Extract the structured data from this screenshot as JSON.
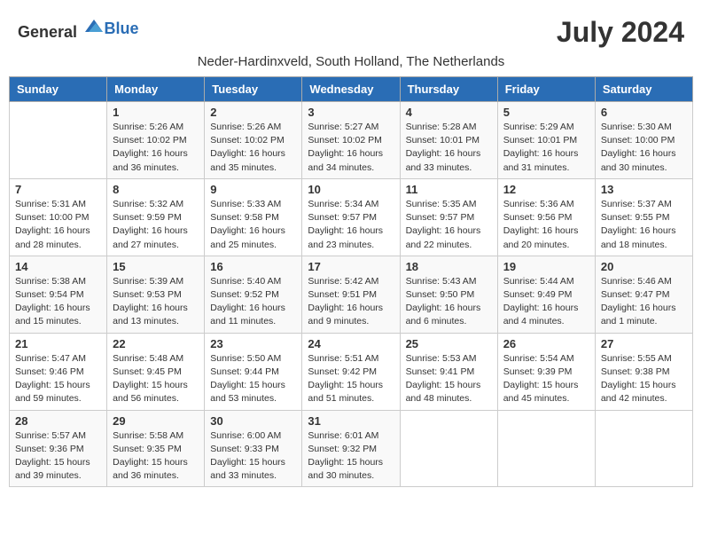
{
  "header": {
    "logo_general": "General",
    "logo_blue": "Blue",
    "month_title": "July 2024",
    "subtitle": "Neder-Hardinxveld, South Holland, The Netherlands"
  },
  "days_of_week": [
    "Sunday",
    "Monday",
    "Tuesday",
    "Wednesday",
    "Thursday",
    "Friday",
    "Saturday"
  ],
  "weeks": [
    [
      {
        "day": "",
        "info": ""
      },
      {
        "day": "1",
        "info": "Sunrise: 5:26 AM\nSunset: 10:02 PM\nDaylight: 16 hours\nand 36 minutes."
      },
      {
        "day": "2",
        "info": "Sunrise: 5:26 AM\nSunset: 10:02 PM\nDaylight: 16 hours\nand 35 minutes."
      },
      {
        "day": "3",
        "info": "Sunrise: 5:27 AM\nSunset: 10:02 PM\nDaylight: 16 hours\nand 34 minutes."
      },
      {
        "day": "4",
        "info": "Sunrise: 5:28 AM\nSunset: 10:01 PM\nDaylight: 16 hours\nand 33 minutes."
      },
      {
        "day": "5",
        "info": "Sunrise: 5:29 AM\nSunset: 10:01 PM\nDaylight: 16 hours\nand 31 minutes."
      },
      {
        "day": "6",
        "info": "Sunrise: 5:30 AM\nSunset: 10:00 PM\nDaylight: 16 hours\nand 30 minutes."
      }
    ],
    [
      {
        "day": "7",
        "info": "Sunrise: 5:31 AM\nSunset: 10:00 PM\nDaylight: 16 hours\nand 28 minutes."
      },
      {
        "day": "8",
        "info": "Sunrise: 5:32 AM\nSunset: 9:59 PM\nDaylight: 16 hours\nand 27 minutes."
      },
      {
        "day": "9",
        "info": "Sunrise: 5:33 AM\nSunset: 9:58 PM\nDaylight: 16 hours\nand 25 minutes."
      },
      {
        "day": "10",
        "info": "Sunrise: 5:34 AM\nSunset: 9:57 PM\nDaylight: 16 hours\nand 23 minutes."
      },
      {
        "day": "11",
        "info": "Sunrise: 5:35 AM\nSunset: 9:57 PM\nDaylight: 16 hours\nand 22 minutes."
      },
      {
        "day": "12",
        "info": "Sunrise: 5:36 AM\nSunset: 9:56 PM\nDaylight: 16 hours\nand 20 minutes."
      },
      {
        "day": "13",
        "info": "Sunrise: 5:37 AM\nSunset: 9:55 PM\nDaylight: 16 hours\nand 18 minutes."
      }
    ],
    [
      {
        "day": "14",
        "info": "Sunrise: 5:38 AM\nSunset: 9:54 PM\nDaylight: 16 hours\nand 15 minutes."
      },
      {
        "day": "15",
        "info": "Sunrise: 5:39 AM\nSunset: 9:53 PM\nDaylight: 16 hours\nand 13 minutes."
      },
      {
        "day": "16",
        "info": "Sunrise: 5:40 AM\nSunset: 9:52 PM\nDaylight: 16 hours\nand 11 minutes."
      },
      {
        "day": "17",
        "info": "Sunrise: 5:42 AM\nSunset: 9:51 PM\nDaylight: 16 hours\nand 9 minutes."
      },
      {
        "day": "18",
        "info": "Sunrise: 5:43 AM\nSunset: 9:50 PM\nDaylight: 16 hours\nand 6 minutes."
      },
      {
        "day": "19",
        "info": "Sunrise: 5:44 AM\nSunset: 9:49 PM\nDaylight: 16 hours\nand 4 minutes."
      },
      {
        "day": "20",
        "info": "Sunrise: 5:46 AM\nSunset: 9:47 PM\nDaylight: 16 hours\nand 1 minute."
      }
    ],
    [
      {
        "day": "21",
        "info": "Sunrise: 5:47 AM\nSunset: 9:46 PM\nDaylight: 15 hours\nand 59 minutes."
      },
      {
        "day": "22",
        "info": "Sunrise: 5:48 AM\nSunset: 9:45 PM\nDaylight: 15 hours\nand 56 minutes."
      },
      {
        "day": "23",
        "info": "Sunrise: 5:50 AM\nSunset: 9:44 PM\nDaylight: 15 hours\nand 53 minutes."
      },
      {
        "day": "24",
        "info": "Sunrise: 5:51 AM\nSunset: 9:42 PM\nDaylight: 15 hours\nand 51 minutes."
      },
      {
        "day": "25",
        "info": "Sunrise: 5:53 AM\nSunset: 9:41 PM\nDaylight: 15 hours\nand 48 minutes."
      },
      {
        "day": "26",
        "info": "Sunrise: 5:54 AM\nSunset: 9:39 PM\nDaylight: 15 hours\nand 45 minutes."
      },
      {
        "day": "27",
        "info": "Sunrise: 5:55 AM\nSunset: 9:38 PM\nDaylight: 15 hours\nand 42 minutes."
      }
    ],
    [
      {
        "day": "28",
        "info": "Sunrise: 5:57 AM\nSunset: 9:36 PM\nDaylight: 15 hours\nand 39 minutes."
      },
      {
        "day": "29",
        "info": "Sunrise: 5:58 AM\nSunset: 9:35 PM\nDaylight: 15 hours\nand 36 minutes."
      },
      {
        "day": "30",
        "info": "Sunrise: 6:00 AM\nSunset: 9:33 PM\nDaylight: 15 hours\nand 33 minutes."
      },
      {
        "day": "31",
        "info": "Sunrise: 6:01 AM\nSunset: 9:32 PM\nDaylight: 15 hours\nand 30 minutes."
      },
      {
        "day": "",
        "info": ""
      },
      {
        "day": "",
        "info": ""
      },
      {
        "day": "",
        "info": ""
      }
    ]
  ]
}
